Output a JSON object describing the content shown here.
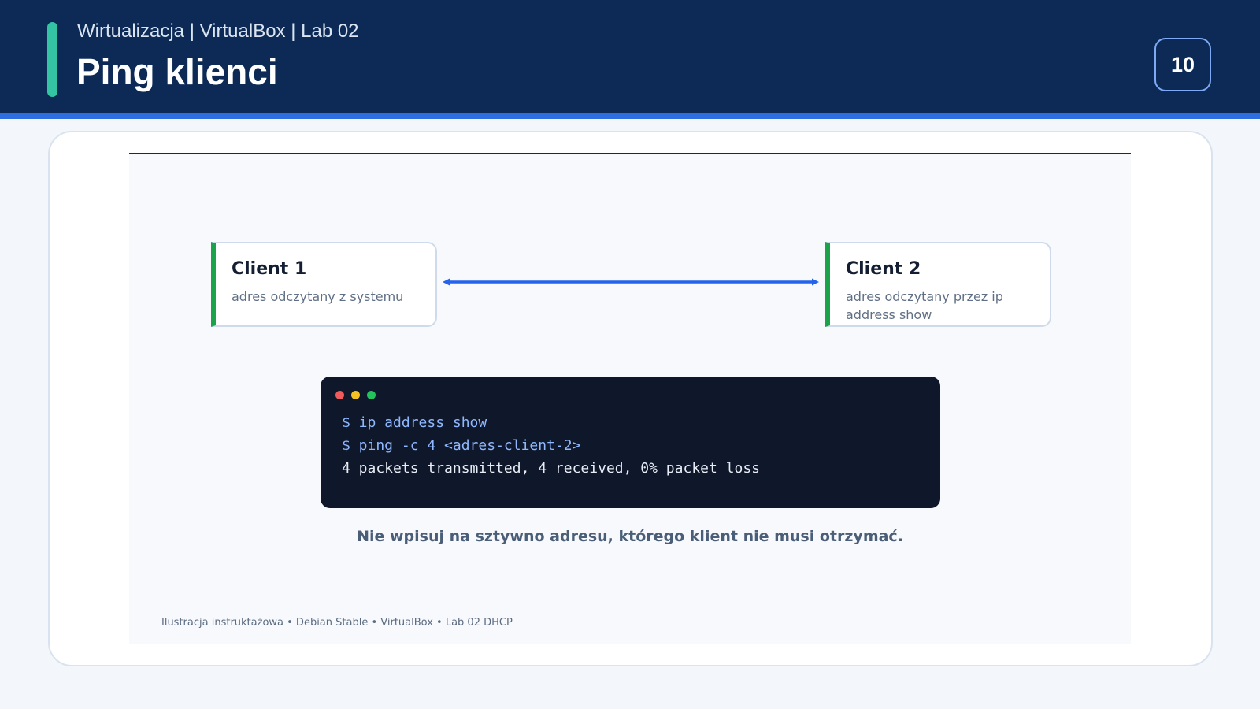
{
  "header": {
    "subtitle": "Wirtualizacja | VirtualBox | Lab 02",
    "title": "Ping klienci",
    "page_number": "10"
  },
  "colors": {
    "header_bg": "#0c2a55",
    "accent_stripe": "#2e6ee0",
    "accent_bar": "#34c3a3",
    "client_border": "#1aa34a",
    "link_arrow": "#2563eb",
    "terminal_bg": "#0f172a"
  },
  "diagram": {
    "client1": {
      "name": "Client 1",
      "description": "adres odczytany z systemu"
    },
    "client2": {
      "name": "Client 2",
      "description": "adres odczytany przez ip address show"
    },
    "link": "bidirectional-arrow"
  },
  "terminal": {
    "lines": [
      "$ ip address show",
      "$ ping -c 4 <adres-client-2>",
      "4 packets transmitted, 4 received, 0% packet loss"
    ]
  },
  "note": "Nie wpisuj na sztywno adresu, którego klient nie musi otrzymać.",
  "footnote": "Ilustracja instruktażowa • Debian Stable • VirtualBox • Lab 02 DHCP"
}
